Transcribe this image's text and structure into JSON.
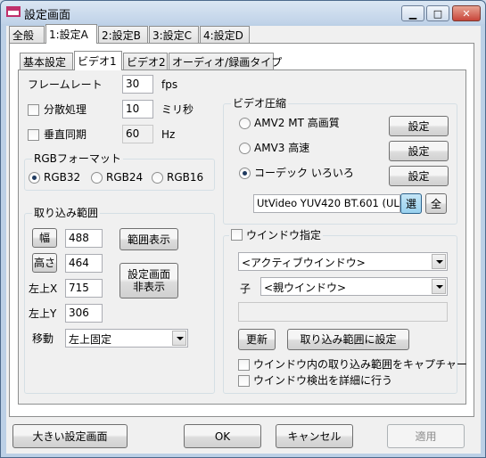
{
  "window": {
    "title": "設定画面",
    "min_glyph": "▁",
    "max_glyph": "□",
    "close_glyph": "✕"
  },
  "main_tabs": [
    "全般",
    "1:設定A",
    "2:設定B",
    "3:設定C",
    "4:設定D"
  ],
  "sub_tabs": [
    "基本設定",
    "ビデオ1",
    "ビデオ2",
    "オーディオ/録画タイプ"
  ],
  "frame": {
    "framerate_label": "フレームレート",
    "framerate_value": "30",
    "framerate_unit": "fps",
    "dispersion_label": "分散処理",
    "dispersion_value": "10",
    "dispersion_unit": "ミリ秒",
    "vsync_label": "垂直同期",
    "vsync_value": "60",
    "vsync_unit": "Hz"
  },
  "rgb": {
    "title": "RGBフォーマット",
    "options": [
      "RGB32",
      "RGB24",
      "RGB16"
    ],
    "selected": "RGB32"
  },
  "capture": {
    "title": "取り込み範囲",
    "width_label": "幅",
    "width_value": "488",
    "height_label": "高さ",
    "height_value": "464",
    "x_label": "左上X",
    "x_value": "715",
    "y_label": "左上Y",
    "y_value": "306",
    "move_label": "移動",
    "move_value": "左上固定",
    "show_range_button": "範囲表示",
    "hide_settings_line1": "設定画面",
    "hide_settings_line2": "非表示"
  },
  "video_compression": {
    "title": "ビデオ圧縮",
    "options": [
      "AMV2 MT 高画質",
      "AMV3 高速",
      "コーデック いろいろ"
    ],
    "selected": "コーデック いろいろ",
    "settings_label": "設定",
    "codec_value": "UtVideo YUV420 BT.601 (UL",
    "select_button": "選",
    "all_button": "全"
  },
  "window_spec": {
    "title": "ウインドウ指定",
    "window_select": "<アクティブウインドウ>",
    "child_label": "子",
    "child_select": "<親ウインドウ>",
    "child_text": "",
    "update_button": "更新",
    "set_range_button": "取り込み範囲に設定",
    "capture_inside_label": "ウインドウ内の取り込み範囲をキャプチャー",
    "detect_detail_label": "ウインドウ検出を詳細に行う"
  },
  "footer": {
    "large_settings": "大きい設定画面",
    "ok": "OK",
    "cancel": "キャンセル",
    "apply": "適用"
  }
}
